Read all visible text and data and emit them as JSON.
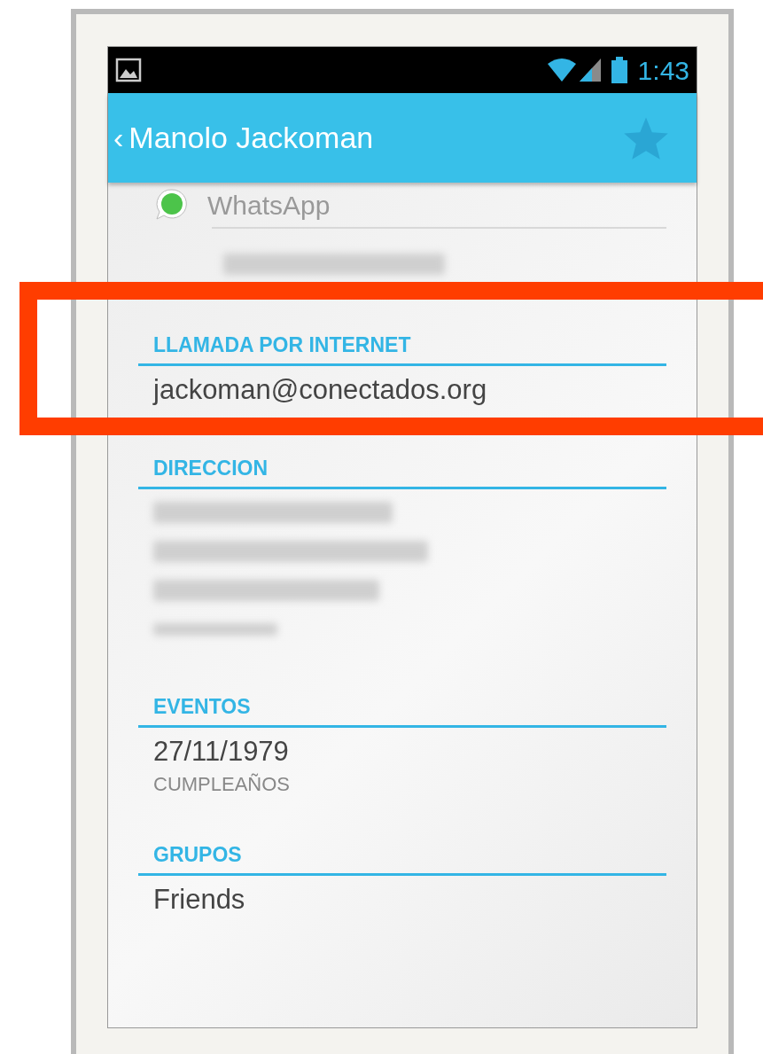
{
  "status_bar": {
    "time": "1:43"
  },
  "action_bar": {
    "back": "‹",
    "title": "Manolo Jackoman",
    "starred": false
  },
  "top_entry": {
    "label": "WhatsApp"
  },
  "sections": [
    {
      "title": "LLAMADA POR INTERNET",
      "highlighted": true,
      "items": [
        {
          "kind": "value",
          "text": "jackoman@conectados.org"
        }
      ]
    },
    {
      "title": "DIRECCION",
      "highlighted": false,
      "items": [
        {
          "kind": "blurred"
        },
        {
          "kind": "blurred"
        },
        {
          "kind": "blurred"
        },
        {
          "kind": "blurred"
        }
      ]
    },
    {
      "title": "EVENTOS",
      "highlighted": false,
      "items": [
        {
          "kind": "value",
          "text": "27/11/1979"
        },
        {
          "kind": "caption",
          "text": "CUMPLEAÑOS"
        }
      ]
    },
    {
      "title": "GRUPOS",
      "highlighted": false,
      "items": [
        {
          "kind": "value",
          "text": "Friends"
        }
      ]
    }
  ]
}
